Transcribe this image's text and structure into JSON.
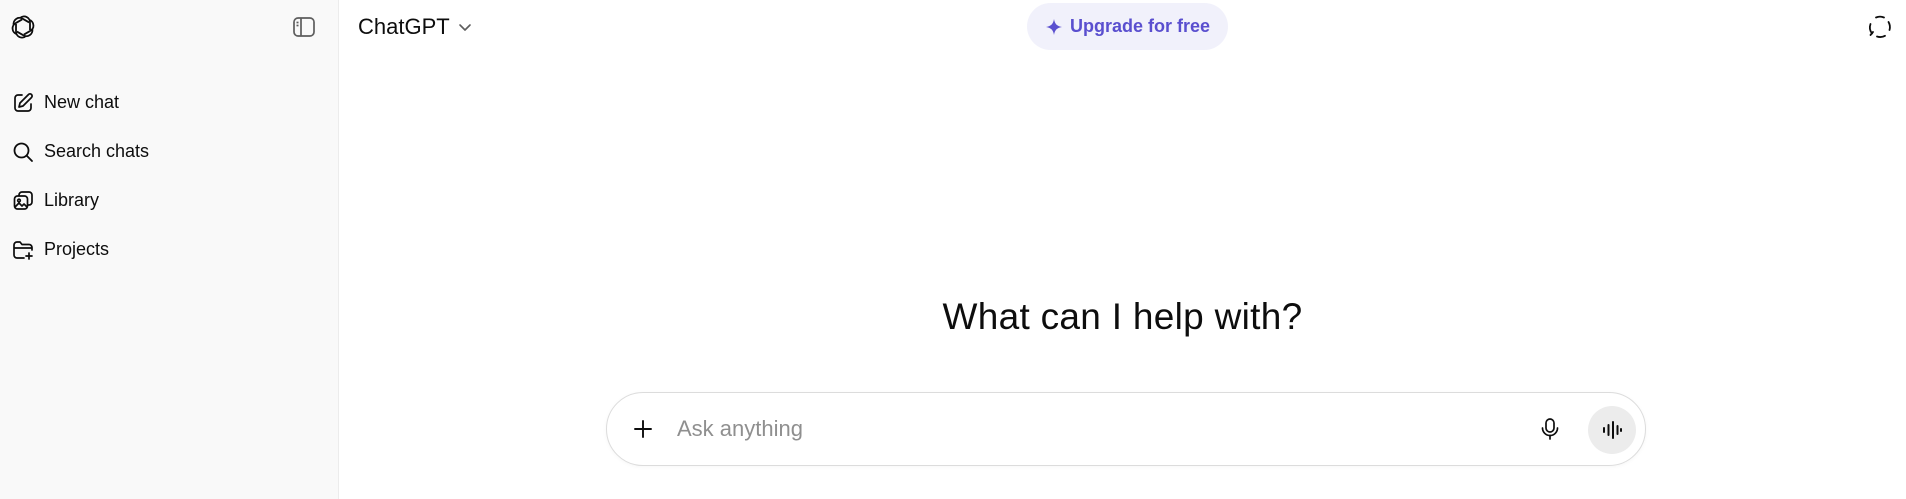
{
  "sidebar": {
    "logo_icon": "openai-logo-icon",
    "toggle_icon": "sidebar-toggle-icon",
    "items": [
      {
        "label": "New chat",
        "icon": "edit-icon"
      },
      {
        "label": "Search chats",
        "icon": "search-icon"
      },
      {
        "label": "Library",
        "icon": "library-icon"
      },
      {
        "label": "Projects",
        "icon": "folder-add-icon"
      }
    ]
  },
  "header": {
    "model_name": "ChatGPT",
    "model_chevron_icon": "chevron-down-icon",
    "upgrade_label": "Upgrade for free",
    "upgrade_icon": "sparkle-icon",
    "temporary_chat_icon": "temporary-chat-icon"
  },
  "main": {
    "heading": "What can I help with?"
  },
  "composer": {
    "placeholder": "Ask anything",
    "value": "",
    "attach_icon": "plus-icon",
    "dictate_icon": "microphone-icon",
    "voice_icon": "voice-mode-icon"
  },
  "colors": {
    "sidebar_bg": "#f9f9f9",
    "upgrade_bg": "#f1f1fb",
    "upgrade_text": "#5a4fcf",
    "voice_button_bg": "#ececec"
  }
}
